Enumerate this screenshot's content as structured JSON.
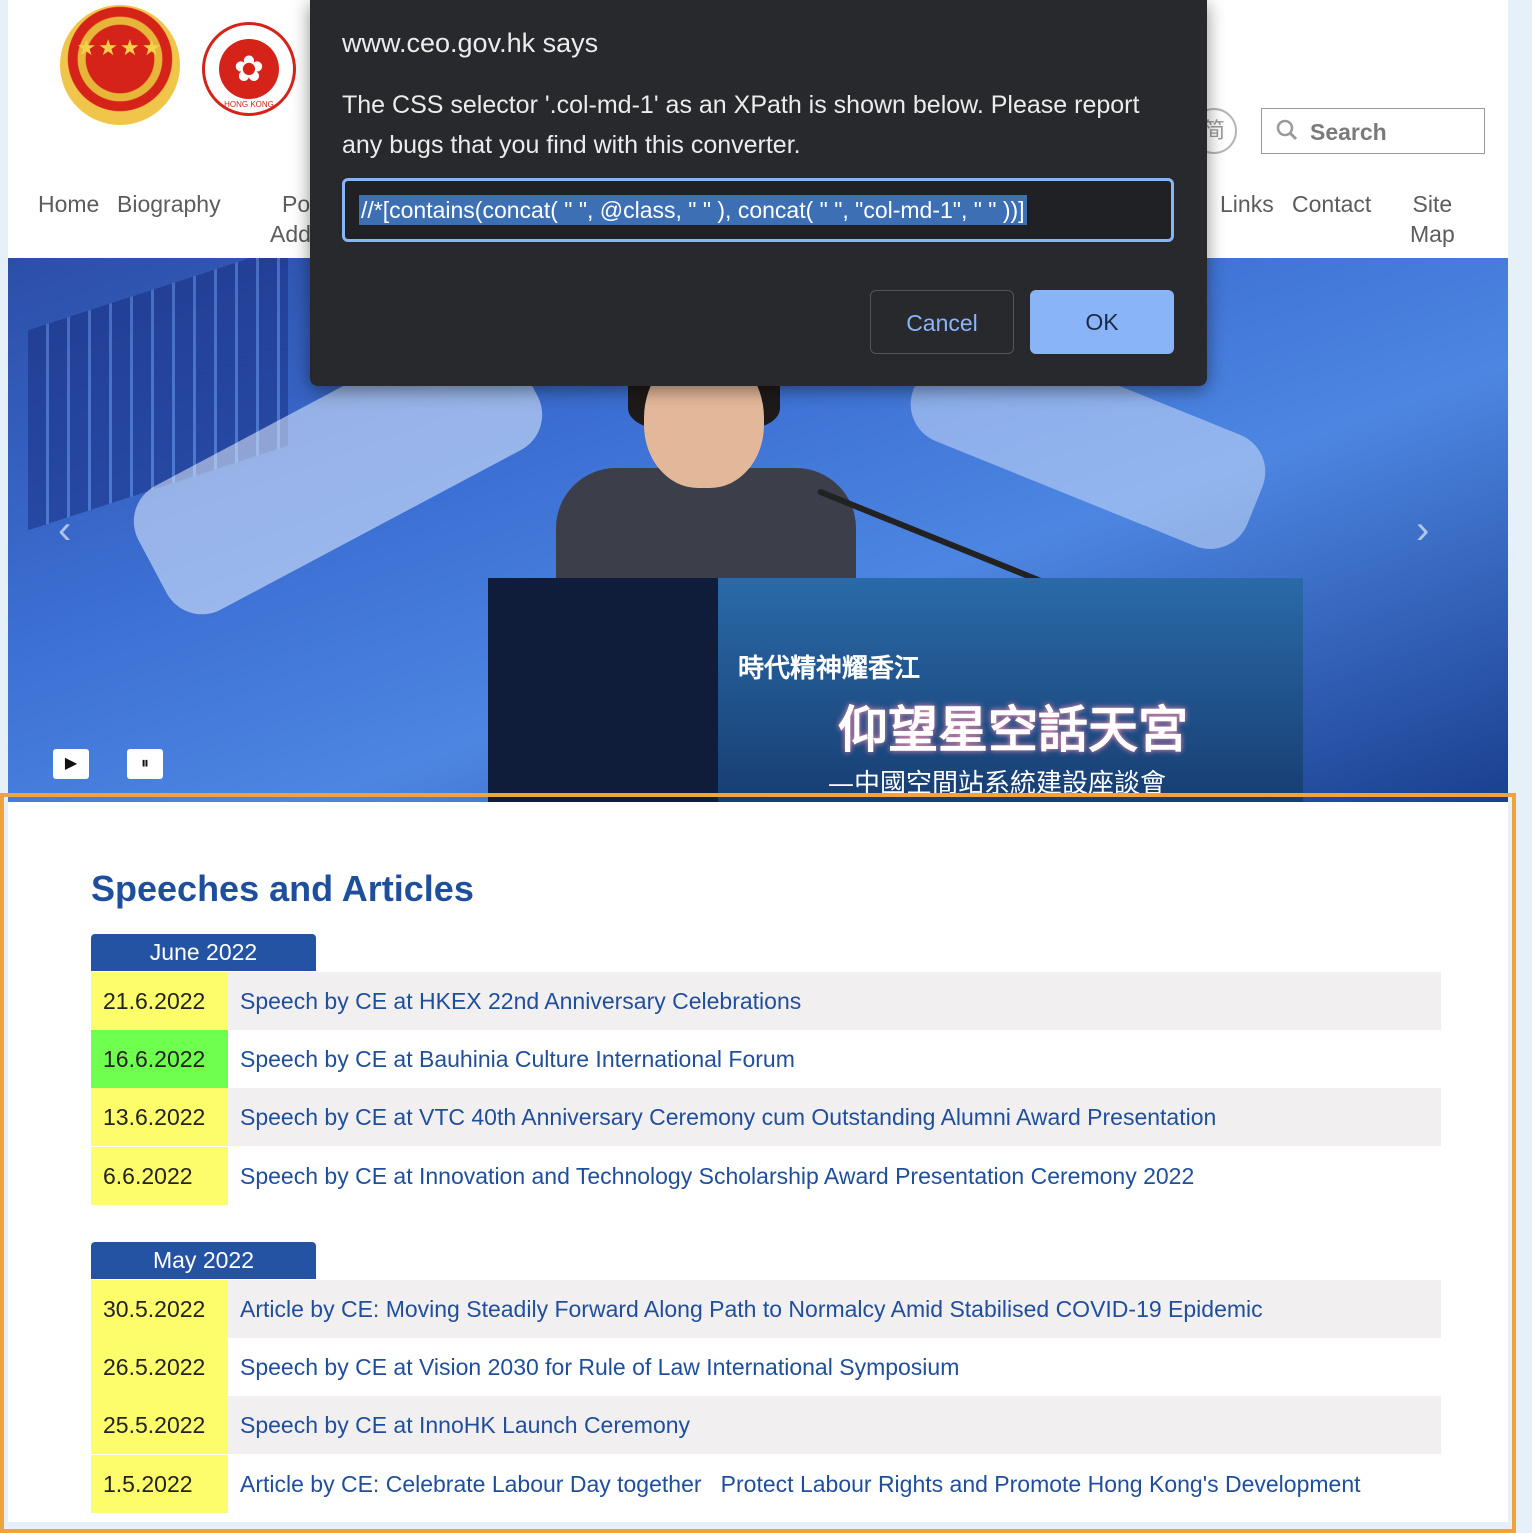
{
  "header": {
    "lang_toggle": "简",
    "search_placeholder": "Search"
  },
  "nav": {
    "home": "Home",
    "biography": "Biography",
    "policy_partial": "Po",
    "policy_partial_2": "Add",
    "links": "Links",
    "contact": "Contact",
    "site_map_1": "Site",
    "site_map_2": "Map"
  },
  "hero": {
    "podium_line1": "時代精神耀香江",
    "podium_line2": "仰望星空話天宮",
    "podium_line3": "—中國空間站系統建設座談會",
    "play_label": "▶",
    "pause_label": "⏸"
  },
  "dialog": {
    "title": "www.ceo.gov.hk says",
    "message": "The CSS selector '.col-md-1' as an XPath is shown below.  Please report any bugs that you find with this converter.",
    "input_value": "//*[contains(concat( \" \", @class, \" \" ), concat( \" \", \"col-md-1\", \" \" ))]",
    "cancel_label": "Cancel",
    "ok_label": "OK"
  },
  "speeches": {
    "title": "Speeches and Articles",
    "months": [
      {
        "label": "June 2022",
        "items": [
          {
            "date": "21.6.2022",
            "title": "Speech by CE at HKEX 22nd Anniversary Celebrations"
          },
          {
            "date": "16.6.2022",
            "title": "Speech by CE at Bauhinia Culture International Forum"
          },
          {
            "date": "13.6.2022",
            "title": "Speech by CE at VTC 40th Anniversary Ceremony cum Outstanding Alumni Award Presentation"
          },
          {
            "date": "6.6.2022",
            "title": "Speech by CE at Innovation and Technology Scholarship Award Presentation Ceremony 2022"
          }
        ]
      },
      {
        "label": "May 2022",
        "items": [
          {
            "date": "30.5.2022",
            "title": "Article by CE: Moving Steadily Forward Along Path to Normalcy Amid Stabilised COVID-19 Epidemic"
          },
          {
            "date": "26.5.2022",
            "title": "Speech by CE at Vision 2030 for Rule of Law International Symposium"
          },
          {
            "date": "25.5.2022",
            "title": "Speech by CE at InnoHK Launch Ceremony"
          },
          {
            "date": "1.5.2022",
            "title": "Article by CE: Celebrate Labour Day together   Protect Labour Rights and Promote Hong Kong's Development"
          }
        ]
      }
    ]
  }
}
